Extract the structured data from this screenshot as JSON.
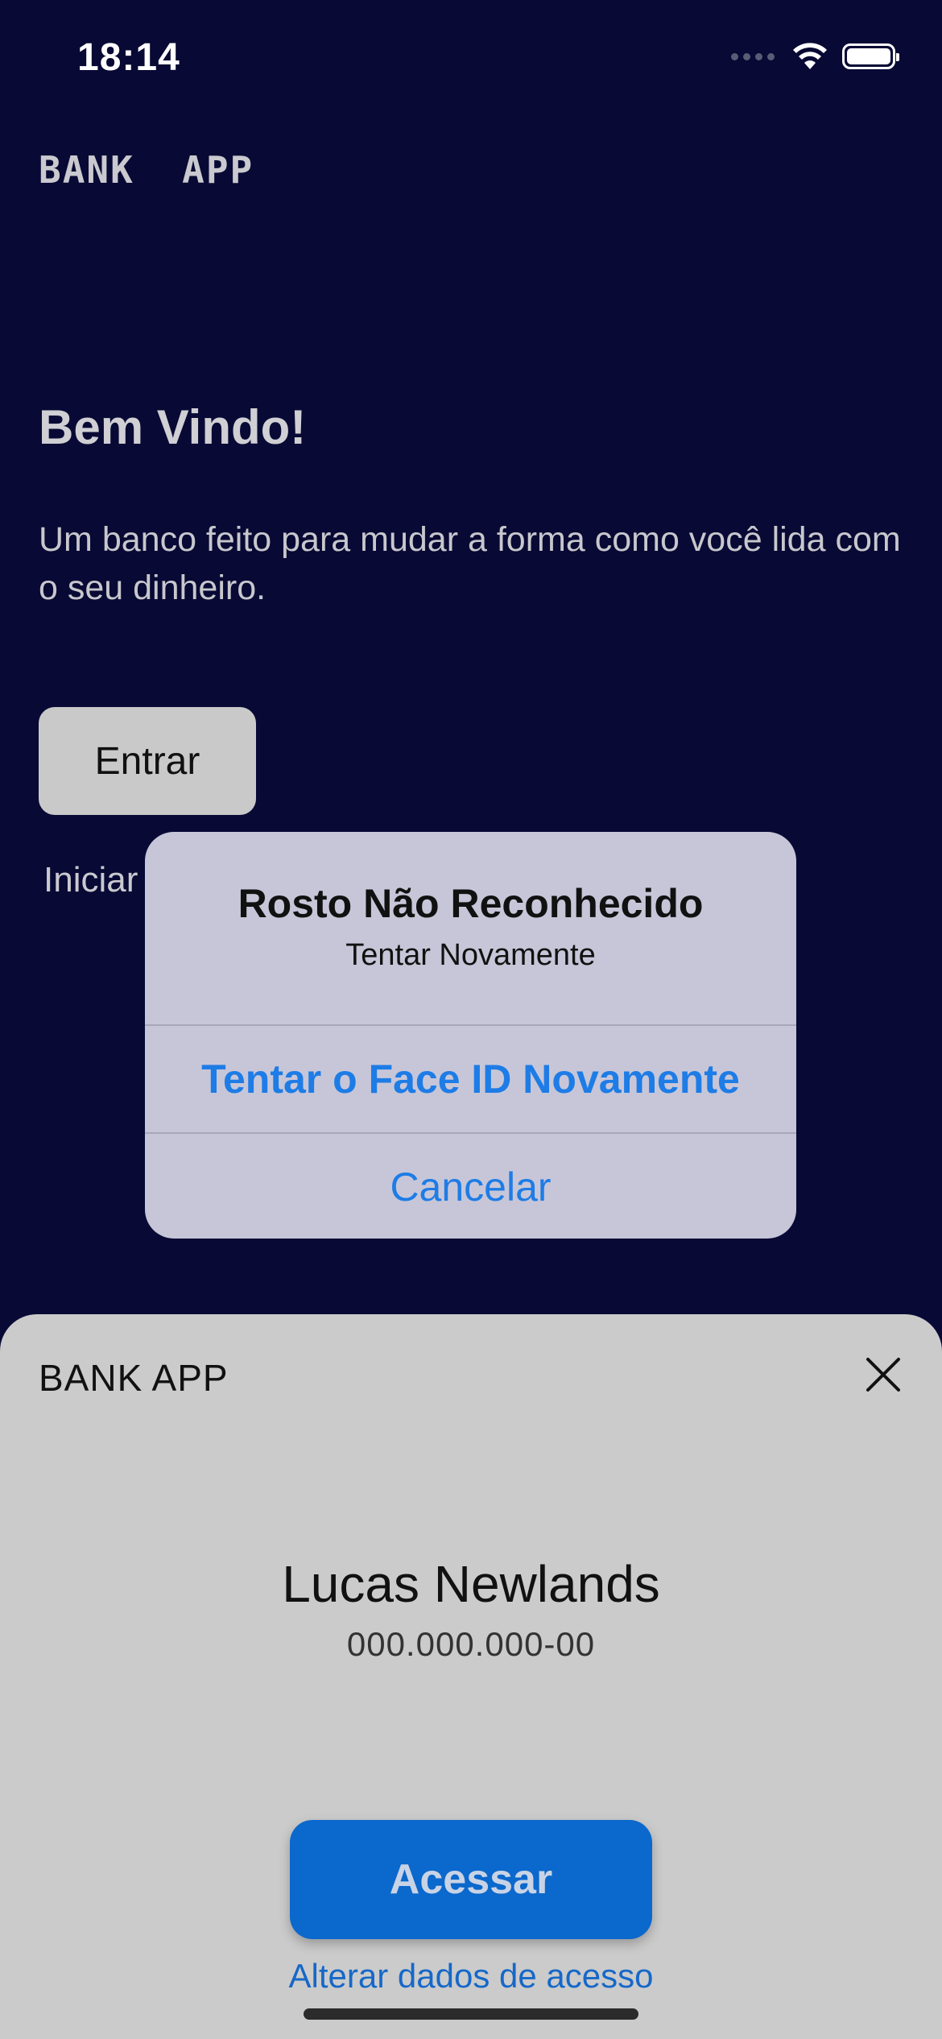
{
  "status_bar": {
    "time": "18:14",
    "icons": [
      "cellular-dots-icon",
      "wifi-icon",
      "battery-icon"
    ]
  },
  "background": {
    "logo": "BANK  APP",
    "welcome_title": "Bem Vindo!",
    "welcome_subtitle": "Um banco feito para mudar a forma como você lida com o seu dinheiro.",
    "enter_button": "Entrar",
    "start_link": "Iniciar"
  },
  "alert": {
    "title": "Rosto Não Reconhecido",
    "message": "Tentar Novamente",
    "primary_action": "Tentar o Face ID Novamente",
    "cancel_action": "Cancelar"
  },
  "sheet": {
    "title": "BANK APP",
    "close_icon": "close-icon",
    "user_name": "Lucas Newlands",
    "user_document": "000.000.000-00",
    "access_button": "Acessar",
    "change_link": "Alterar dados de acesso"
  },
  "colors": {
    "background": "#080934",
    "accent_blue": "#0b68cc",
    "alert_link_blue": "#1e7ce6",
    "sheet_bg": "#cbcbcb",
    "alert_bg": "#c7c6d8"
  }
}
